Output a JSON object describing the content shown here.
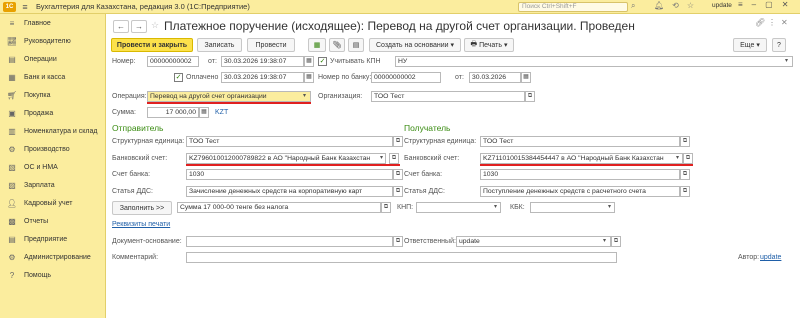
{
  "titlebar": {
    "app_title": "Бухгалтерия для Казахстана, редакция 3.0  (1С:Предприятие)",
    "search_placeholder": "Поиск Ctrl+Shift+F",
    "user": "update"
  },
  "sidebar": {
    "items": [
      {
        "label": "Главное",
        "icon": "menu-icon"
      },
      {
        "label": "Руководителю",
        "icon": "chart-icon"
      },
      {
        "label": "Операции",
        "icon": "operations-icon"
      },
      {
        "label": "Банк и касса",
        "icon": "bank-icon"
      },
      {
        "label": "Покупка",
        "icon": "cart-icon"
      },
      {
        "label": "Продажа",
        "icon": "sale-icon"
      },
      {
        "label": "Номенклатура и склад",
        "icon": "warehouse-icon"
      },
      {
        "label": "Производство",
        "icon": "production-icon"
      },
      {
        "label": "ОС и НМА",
        "icon": "assets-icon"
      },
      {
        "label": "Зарплата",
        "icon": "salary-icon"
      },
      {
        "label": "Кадровый учет",
        "icon": "personnel-icon"
      },
      {
        "label": "Отчеты",
        "icon": "reports-icon"
      },
      {
        "label": "Предприятие",
        "icon": "enterprise-icon"
      },
      {
        "label": "Администрирование",
        "icon": "admin-icon"
      },
      {
        "label": "Помощь",
        "icon": "help-icon"
      }
    ]
  },
  "doc": {
    "title": "Платежное поручение (исходящее): Перевод на другой счет организации. Проведен"
  },
  "toolbar": {
    "post_close": "Провести и закрыть",
    "save": "Записать",
    "post": "Провести",
    "create_based": "Создать на основании",
    "print": "Печать",
    "more": "Еще",
    "help": "?"
  },
  "form": {
    "number_label": "Номер:",
    "number_value": "00000000002",
    "from_label": "от:",
    "date_value": "30.03.2026 19:38:07",
    "kpn_label": "Учитывать КПН",
    "kpn_value": "НУ",
    "paid_label": "Оплачено",
    "paid_date": "30.03.2026 19:38:07",
    "bank_number_label": "Номер по банку:",
    "bank_number_value": "00000000002",
    "bank_from_label": "от:",
    "bank_date": "30.03.2026",
    "operation_label": "Операция:",
    "operation_value": "Перевод на другой счет организации",
    "org_label": "Организация:",
    "org_value": "ТОО Тест",
    "sum_label": "Сумма:",
    "sum_value": "17 000,00",
    "currency": "KZT"
  },
  "sender": {
    "header": "Отправитель",
    "unit_label": "Структурная единица:",
    "unit_value": "ТОО Тест",
    "account_label": "Банковский счет:",
    "account_value": "KZ796010012000789822 в АО \"Народный Банк Казахстан",
    "bank_acc_label": "Счет банка:",
    "bank_acc_value": "1030",
    "dds_label": "Статья ДДС:",
    "dds_value": "Зачисление денежных средств на корпоративную карт"
  },
  "receiver": {
    "header": "Получатель",
    "unit_label": "Структурная единица:",
    "unit_value": "ТОО Тест",
    "account_label": "Банковский счет:",
    "account_value": "KZ711010015384454447 в АО \"Народный Банк Казахстан",
    "bank_acc_label": "Счет банка:",
    "bank_acc_value": "1030",
    "dds_label": "Статья ДДС:",
    "dds_value": "Поступление денежных средств с расчетного счета"
  },
  "bottom": {
    "fill_button": "Заполнить >>",
    "purpose_value": "Сумма 17 000-00  тенге  без налога",
    "knp_label": "КНП:",
    "kbk_label": "КБК:",
    "print_details_link": "Реквизиты печати",
    "base_doc_label": "Документ-основание:",
    "responsible_label": "Ответственный:",
    "responsible_value": "update",
    "comment_label": "Комментарий:",
    "author_label": "Автор:",
    "author_value": "update"
  }
}
